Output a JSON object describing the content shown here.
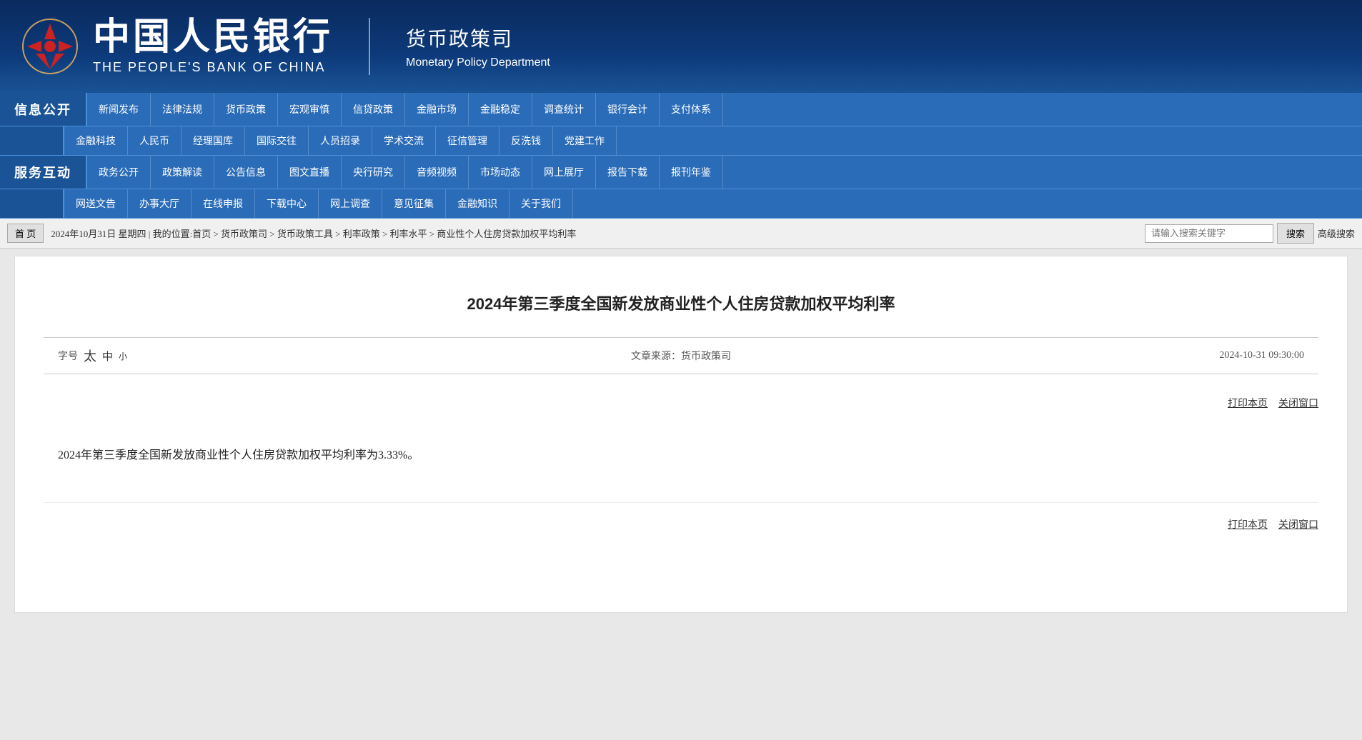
{
  "header": {
    "bank_name_cn": "中国人民银行",
    "bank_name_en": "THE PEOPLE'S BANK OF CHINA",
    "dept_cn": "货币政策司",
    "dept_en": "Monetary Policy Department"
  },
  "nav": {
    "row1_label": "信息公开",
    "row1_items": [
      "新闻发布",
      "法律法规",
      "货币政策",
      "宏观审慎",
      "信贷政策",
      "金融市场",
      "金融稳定",
      "调查统计",
      "银行会计",
      "支付体系"
    ],
    "row2_items": [
      "金融科技",
      "人民币",
      "经理国库",
      "国际交往",
      "人员招录",
      "学术交流",
      "征信管理",
      "反洗钱",
      "党建工作"
    ],
    "row3_label": "服务互动",
    "row3_items": [
      "政务公开",
      "政策解读",
      "公告信息",
      "图文直播",
      "央行研究",
      "音频视频",
      "市场动态",
      "网上展厅",
      "报告下载",
      "报刊年鉴"
    ],
    "row4_items": [
      "网送文告",
      "办事大厅",
      "在线申报",
      "下载中心",
      "网上调查",
      "意见征集",
      "金融知识",
      "关于我们"
    ]
  },
  "breadcrumb": {
    "home": "首 页",
    "path": "2024年10月31日 星期四 | 我的位置:首页 > 货币政策司 > 货币政策工具 > 利率政策 > 利率水平 > 商业性个人住房贷款加权平均利率",
    "search_placeholder": "请输入搜索关键字",
    "search_btn": "搜索",
    "advanced": "高级搜索"
  },
  "article": {
    "title": "2024年第三季度全国新发放商业性个人住房贷款加权平均利率",
    "font_label": "字号",
    "font_large": "太",
    "font_medium": "中",
    "font_small": "小",
    "source_label": "文章来源：",
    "source": "货币政策司",
    "date": "2024-10-31 09:30:00",
    "print": "打印本页",
    "close": "关闭窗口",
    "body": "2024年第三季度全国新发放商业性个人住房贷款加权平均利率为3.33%。",
    "print_bottom": "打印本页",
    "close_bottom": "关闭窗口"
  }
}
